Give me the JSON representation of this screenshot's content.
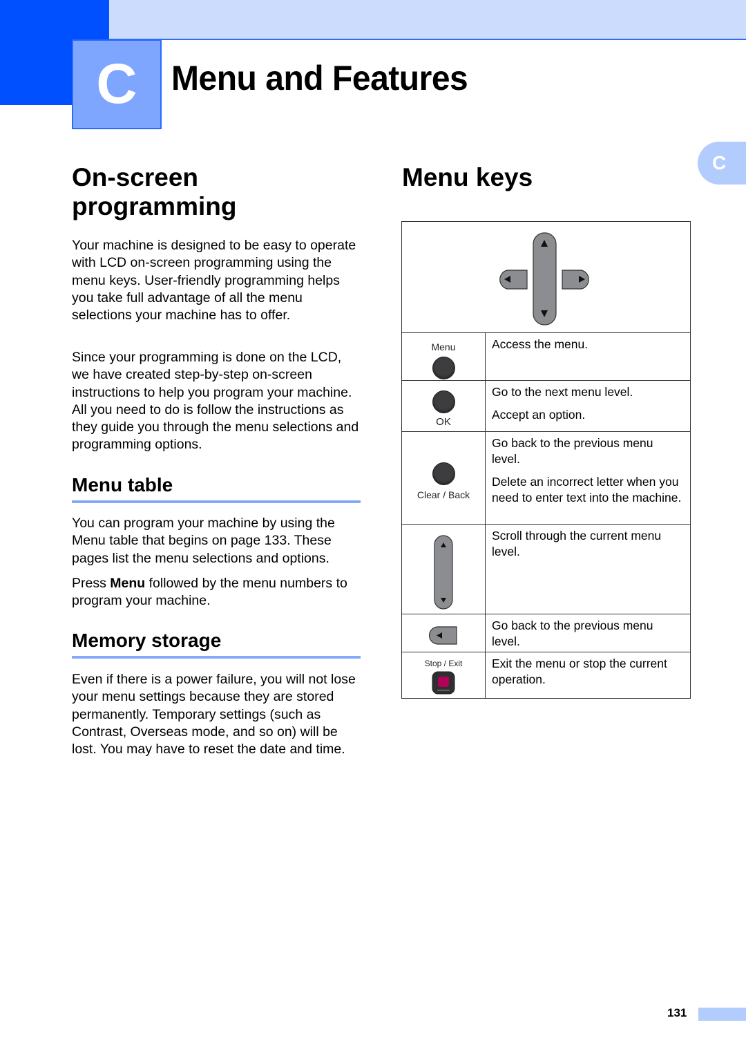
{
  "chapter": {
    "letter": "C",
    "title": "Menu and Features",
    "side_tab": "C",
    "colors": {
      "dark_blue": "#0050ff",
      "light_blue": "#ccdcfd",
      "box_blue": "#7ea6ff",
      "rule_blue": "#86a8fb",
      "stop_key": "#b00058"
    }
  },
  "left": {
    "section_title": "On-screen programming",
    "section_title_line1": "On-screen",
    "section_title_line2": "programming",
    "paragraphs": [
      "Your machine is designed to be easy to operate with LCD on-screen programming using the menu keys. User-friendly programming helps you take full advantage of all the menu selections your machine has to offer.",
      "Since your programming is done on the LCD, we have created step-by-step on-screen instructions to help you program your machine. All you need to do is follow the instructions as they guide you through the menu selections and programming options."
    ],
    "menu_table": {
      "title": "Menu table",
      "p1": "You can program your machine by using the Menu table that begins on page 133. These pages list the menu selections and options.",
      "p2_prefix": "Press ",
      "p2_bold": "Menu",
      "p2_suffix": " followed by the menu numbers to program your machine."
    },
    "memory_storage": {
      "title": "Memory storage",
      "p1": "Even if there is a power failure, you will not lose your menu settings because they are stored permanently. Temporary settings (such as Contrast, Overseas mode, and so on) will be lost. You may have to reset the date and time."
    }
  },
  "right": {
    "section_title": "Menu keys",
    "rows": [
      {
        "key_label": "Menu",
        "icon": "round-key-icon",
        "descriptions": [
          "Access the menu."
        ]
      },
      {
        "key_label": "OK",
        "icon": "round-key-icon",
        "descriptions": [
          "Go to the next menu level.",
          "Accept an option."
        ]
      },
      {
        "key_label": "Clear / Back",
        "icon": "round-key-icon",
        "descriptions": [
          "Go back to the previous menu level.",
          "Delete an incorrect letter when you need to enter text into the machine."
        ]
      },
      {
        "key_label": "",
        "icon": "up-down-key-icon",
        "descriptions": [
          "Scroll through the current menu level."
        ]
      },
      {
        "key_label": "",
        "icon": "left-arrow-key-icon",
        "descriptions": [
          "Go back to the previous menu level."
        ]
      },
      {
        "key_label": "Stop / Exit",
        "icon": "stop-key-icon",
        "descriptions": [
          "Exit the menu or stop the current operation."
        ]
      }
    ]
  },
  "footer": {
    "page_number": "131"
  }
}
